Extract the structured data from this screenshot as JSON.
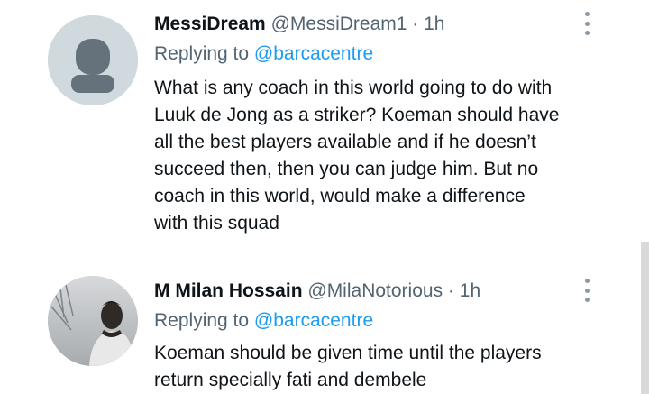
{
  "tweets": [
    {
      "display_name": "MessiDream",
      "handle": "@MessiDream1",
      "separator": "·",
      "time": "1h",
      "replying_prefix": "Replying to",
      "replying_to": "@barcacentre",
      "body_lines": [
        "What is any coach in this world going to do with",
        "Luuk de Jong as a striker? Koeman should have",
        "all the best players available and if he doesn’t",
        "succeed then, then you can judge him. But no",
        "coach in this world, would make a difference",
        "with this squad"
      ],
      "avatar": "default-avatar"
    },
    {
      "display_name": "M Milan Hossain",
      "handle": "@MilaNotorious",
      "separator": "·",
      "time": "1h",
      "replying_prefix": "Replying to",
      "replying_to": "@barcacentre",
      "body_lines": [
        "Koeman should be given time until the players",
        "return specially fati and dembele"
      ],
      "avatar": "profile-photo"
    }
  ],
  "icons": {
    "more": "more-vertical-icon"
  },
  "colors": {
    "text": "#0f1419",
    "secondary": "#536471",
    "link": "#1d9bf0",
    "default_avatar_bg": "#cfd9de"
  }
}
